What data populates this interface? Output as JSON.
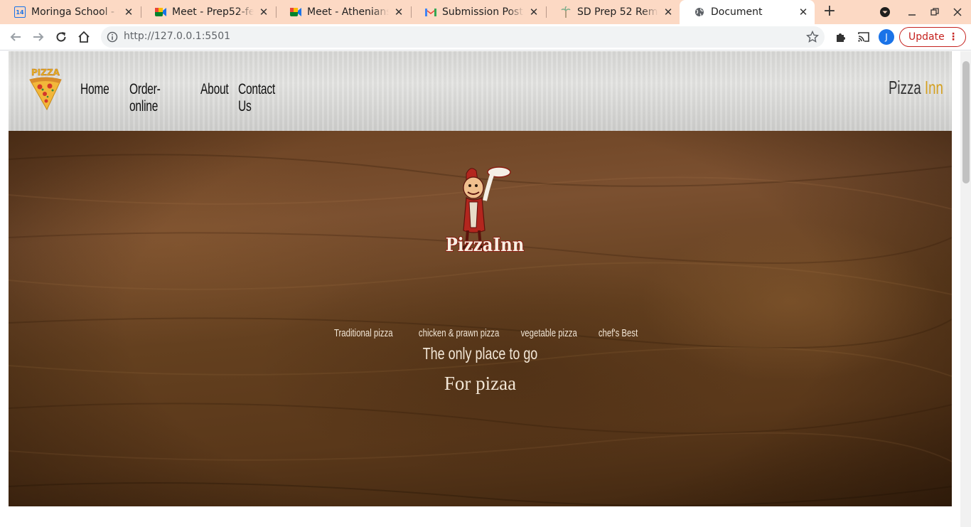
{
  "browser": {
    "tabs": [
      {
        "title": "Moringa School - C",
        "favicon": "calendar-icon",
        "color": "#1a73e8"
      },
      {
        "title": "Meet - Prep52-feed",
        "favicon": "meet-icon",
        "color": "#00832d"
      },
      {
        "title": "Meet - Athenians M",
        "favicon": "meet-icon",
        "color": "#00832d"
      },
      {
        "title": "Submission Posted",
        "favicon": "gmail-icon",
        "color": "#ea4335"
      },
      {
        "title": "SD Prep 52 Remote",
        "favicon": "palm-icon",
        "color": "#8ab4a0"
      },
      {
        "title": "Document",
        "favicon": "globe-icon",
        "color": "#5f6368"
      }
    ],
    "calendar_badge": "14",
    "url_host": "http://127.0.0.1",
    "url_port": ":5501",
    "profile_initial": "J",
    "update_label": "Update",
    "tab_strip_color": "#fcd9c4"
  },
  "site": {
    "logo_text": "PIZZA",
    "nav": [
      "Home",
      "Order-online",
      "About",
      "Contact Us"
    ],
    "brand_part1": "Pizza",
    "brand_part2": "Inn",
    "brand_accent": "#d4a020"
  },
  "hero": {
    "logo_text": "PizzaInn",
    "links": [
      "Traditional pizza",
      "chicken & prawn pizza",
      "vegetable pizza",
      "chef's Best"
    ],
    "subtitle": "The only place to go",
    "tagline": "For pizaa"
  }
}
